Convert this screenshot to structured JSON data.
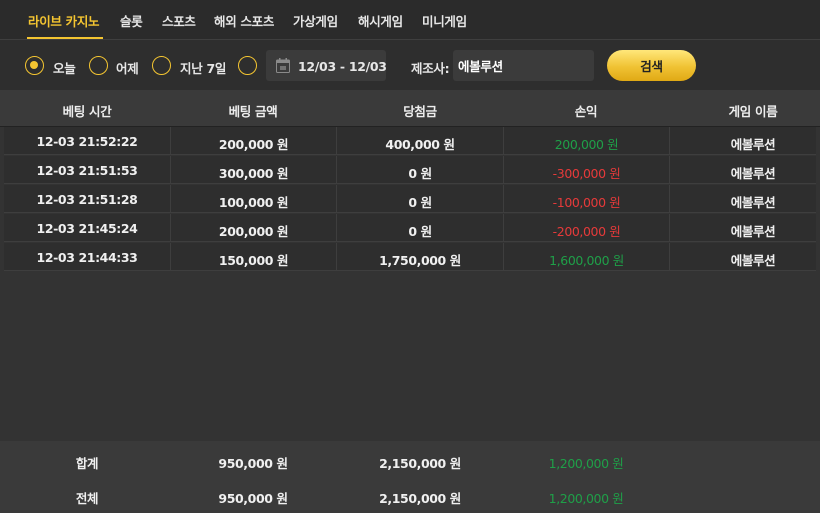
{
  "tabs": [
    {
      "label": "라이브 카지노",
      "active": true
    },
    {
      "label": "슬롯"
    },
    {
      "label": "스포츠"
    },
    {
      "label": "해외 스포츠"
    },
    {
      "label": "가상게임"
    },
    {
      "label": "해시게임"
    },
    {
      "label": "미니게임"
    }
  ],
  "filters": {
    "radio_today": "오늘",
    "radio_yesterday": "어제",
    "radio_last7": "지난 7일",
    "selected": "오늘",
    "date_range": "12/03 - 12/03",
    "maker_label": "제조사:",
    "maker_value": "에볼루션",
    "search_label": "검색"
  },
  "table": {
    "headers": [
      "베팅 시간",
      "베팅 금액",
      "당첨금",
      "손익",
      "게임 이름"
    ],
    "rows": [
      [
        "12-03 21:52:22",
        "200,000 원",
        "400,000 원",
        "200,000 원",
        "에볼루션"
      ],
      [
        "12-03 21:51:53",
        "300,000 원",
        "0 원",
        "-300,000 원",
        "에볼루션"
      ],
      [
        "12-03 21:51:28",
        "100,000 원",
        "0 원",
        "-100,000 원",
        "에볼루션"
      ],
      [
        "12-03 21:45:24",
        "200,000 원",
        "0 원",
        "-200,000 원",
        "에볼루션"
      ],
      [
        "12-03 21:44:33",
        "150,000 원",
        "1,750,000 원",
        "1,600,000 원",
        "에볼루션"
      ]
    ]
  },
  "totals": {
    "sum": {
      "label": "합계",
      "bet": "950,000 원",
      "win": "2,150,000 원",
      "profit": "1,200,000 원"
    },
    "all": {
      "label": "전체",
      "bet": "950,000 원",
      "win": "2,150,000 원",
      "profit": "1,200,000 원"
    }
  },
  "colors": {
    "accent": "#f4c531",
    "positive": "#1f9f48",
    "negative": "#e63a3a"
  }
}
